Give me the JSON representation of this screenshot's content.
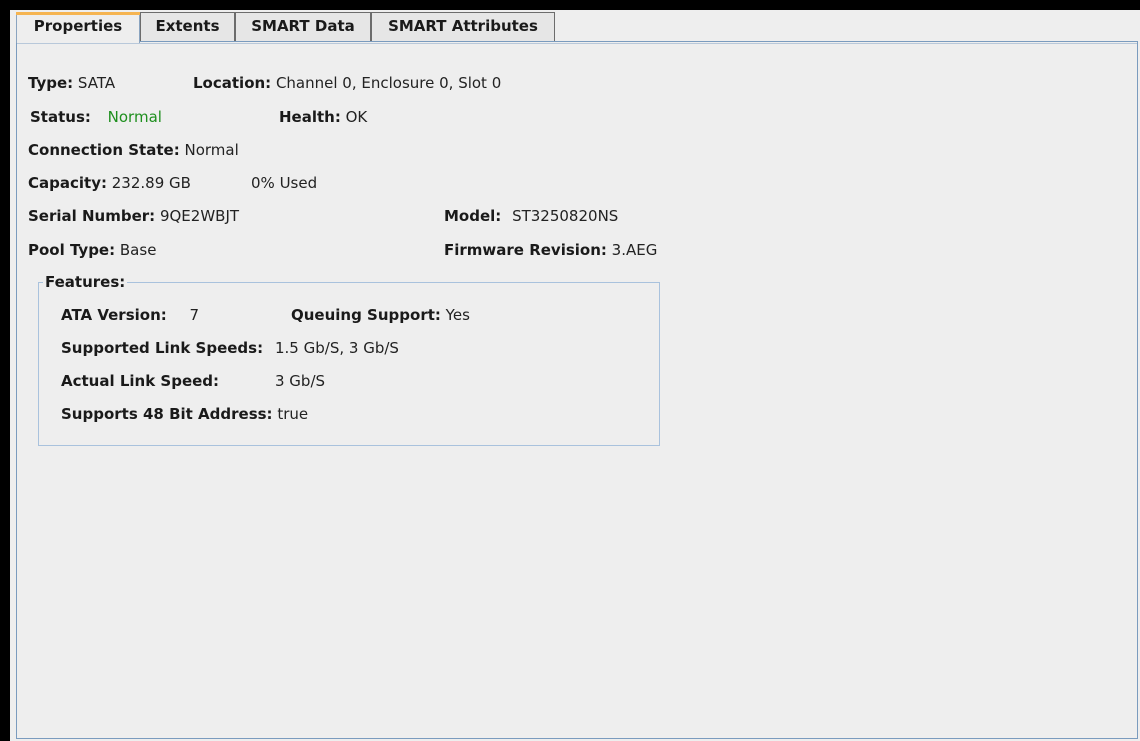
{
  "tabs": [
    {
      "label": "Properties"
    },
    {
      "label": "Extents"
    },
    {
      "label": "SMART Data"
    },
    {
      "label": "SMART Attributes"
    }
  ],
  "properties": {
    "type_label": "Type:",
    "type_value": "SATA",
    "location_label": "Location:",
    "location_value": "Channel 0, Enclosure 0, Slot 0",
    "status_label": "Status:",
    "status_value": "Normal",
    "health_label": "Health:",
    "health_value": "OK",
    "connection_state_label": "Connection State:",
    "connection_state_value": "Normal",
    "capacity_label": "Capacity:",
    "capacity_value": "232.89 GB",
    "used_value": "0% Used",
    "serial_label": "Serial Number:",
    "serial_value": "9QE2WBJT",
    "model_label": "Model:",
    "model_value": "ST3250820NS",
    "pool_type_label": "Pool Type:",
    "pool_type_value": "Base",
    "firmware_label": "Firmware Revision:",
    "firmware_value": "3.AEG"
  },
  "features": {
    "legend": "Features:",
    "ata_version_label": "ATA Version:",
    "ata_version_value": "7",
    "queuing_label": "Queuing Support:",
    "queuing_value": "Yes",
    "link_speeds_label": "Supported Link Speeds:",
    "link_speeds_value": "1.5 Gb/S, 3 Gb/S",
    "actual_speed_label": "Actual Link Speed:",
    "actual_speed_value": "3 Gb/S",
    "bit48_label": "Supports 48 Bit Address:",
    "bit48_value": "true"
  },
  "colors": {
    "status_normal": "#1e8f1e",
    "active_tab_accent": "#f5b451",
    "panel_border": "#7a9bbe"
  }
}
